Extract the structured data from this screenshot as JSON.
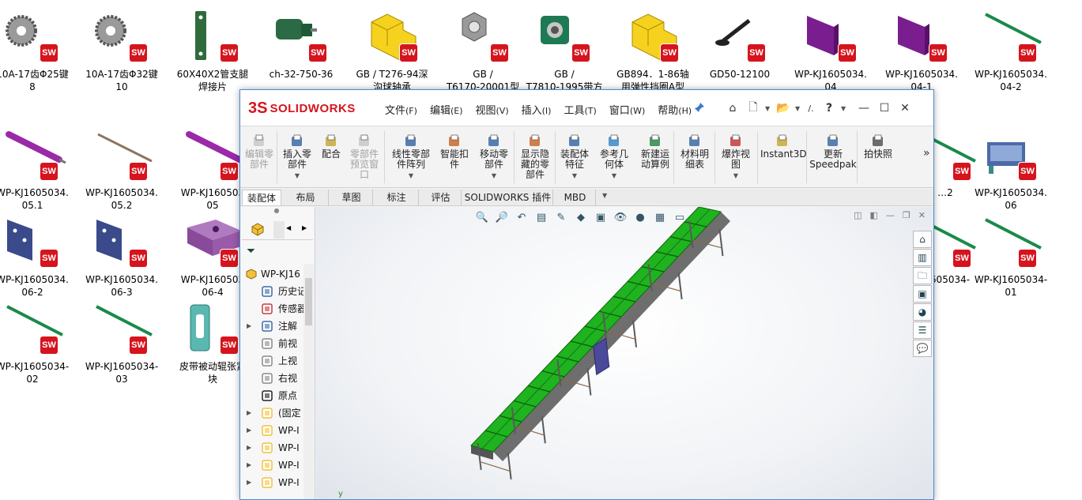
{
  "desktop": {
    "files": [
      {
        "label": "10A-17齿Φ25键\n8",
        "thumb": "sprocket-icon"
      },
      {
        "label": "10A-17齿Φ32键\n10",
        "thumb": "sprocket-icon"
      },
      {
        "label": "60X40X2管支腿\n焊接片",
        "thumb": "plate-icon"
      },
      {
        "label": "ch-32-750-36",
        "thumb": "motor-icon"
      },
      {
        "label": "GB / T276-94深\n沟球轴承",
        "thumb": "block-icon"
      },
      {
        "label": "GB /\nT6170-20001型",
        "thumb": "nut-icon"
      },
      {
        "label": "GB /\nT7810-1995带方",
        "thumb": "bearing-icon"
      },
      {
        "label": "GB894．1-86轴\n用弹性挡圈A型",
        "thumb": "block-icon"
      },
      {
        "label": "GD50-12100",
        "thumb": "foot-icon"
      },
      {
        "label": "WP-KJ1605034.\n04",
        "thumb": "panel-icon"
      },
      {
        "label": "WP-KJ1605034.\n04-1",
        "thumb": "panel-icon"
      },
      {
        "label": "WP-KJ1605034.\n04-2",
        "thumb": "rod-icon"
      },
      {
        "label": "WP-KJ1605034.\n05.1",
        "thumb": "roller-icon"
      },
      {
        "label": "WP-KJ1605034.\n05.2",
        "thumb": "shaft-icon"
      },
      {
        "label": "WP-KJ160503\n05",
        "thumb": "roller-icon"
      },
      {
        "label": "WP-KJ1605034.\n06",
        "thumb": "machine-icon"
      },
      {
        "label": "…2",
        "thumb": "rod-icon"
      },
      {
        "label": "WP-KJ1605034.\n06-2",
        "thumb": "bracket-icon"
      },
      {
        "label": "WP-KJ1605034.\n06-3",
        "thumb": "bracket-icon"
      },
      {
        "label": "WP-KJ160503\n06-4",
        "thumb": "block-purple-icon"
      },
      {
        "label": "…605034-",
        "thumb": "rod-icon"
      },
      {
        "label": "WP-KJ1605034-\n01",
        "thumb": "rod-icon"
      },
      {
        "label": "WP-KJ1605034-\n02",
        "thumb": "rod-icon"
      },
      {
        "label": "WP-KJ1605034-\n03",
        "thumb": "rod-icon"
      },
      {
        "label": "皮带被动辊张紧\n块",
        "thumb": "tensioner-icon"
      }
    ],
    "badge": "SW"
  },
  "app": {
    "logo_ds": "3S",
    "logo_name": "SOLIDWORKS",
    "menus": [
      {
        "label": "文件",
        "acc": "(F)"
      },
      {
        "label": "编辑",
        "acc": "(E)"
      },
      {
        "label": "视图",
        "acc": "(V)"
      },
      {
        "label": "插入",
        "acc": "(I)"
      },
      {
        "label": "工具",
        "acc": "(T)"
      },
      {
        "label": "窗口",
        "acc": "(W)"
      },
      {
        "label": "帮助",
        "acc": "(H)"
      }
    ],
    "title_tools": {
      "home": "⌂",
      "new": "🗋",
      "open": "📂",
      "search_text": "/.",
      "help": "?"
    },
    "window_controls": {
      "minimize": "—",
      "maximize": "☐",
      "close": "✕"
    }
  },
  "commands": [
    {
      "label": "编辑零\n部件",
      "disabled": true
    },
    {
      "label": "插入零\n部件",
      "disabled": false,
      "dropdown": true
    },
    {
      "label": "配合",
      "disabled": false
    },
    {
      "label": "零部件\n预览窗\n口",
      "disabled": true
    },
    {
      "label": "线性零部\n件阵列",
      "disabled": false,
      "dropdown": true
    },
    {
      "label": "智能扣\n件",
      "disabled": false
    },
    {
      "label": "移动零\n部件",
      "disabled": false,
      "dropdown": true
    },
    {
      "label": "显示隐\n藏的零\n部件",
      "disabled": false
    },
    {
      "label": "装配体\n特征",
      "disabled": false,
      "dropdown": true
    },
    {
      "label": "参考几\n何体",
      "disabled": false,
      "dropdown": true
    },
    {
      "label": "新建运\n动算例",
      "disabled": false
    },
    {
      "label": "材料明\n细表",
      "disabled": false
    },
    {
      "label": "爆炸视\n图",
      "disabled": false,
      "dropdown": true
    },
    {
      "label": "Instant3D",
      "disabled": false
    },
    {
      "label": "更新\nSpeedpak",
      "disabled": false
    },
    {
      "label": "拍快照",
      "disabled": false
    }
  ],
  "more_glyph": "»",
  "tabs": [
    "装配体",
    "布局",
    "草图",
    "标注",
    "评估",
    "SOLIDWORKS 插件",
    "MBD"
  ],
  "tree": {
    "root": "WP-KJ16",
    "items": [
      {
        "label": "历史记",
        "icon": "history-icon",
        "arrow": ""
      },
      {
        "label": "传感器",
        "icon": "sensor-icon",
        "arrow": ""
      },
      {
        "label": "注解",
        "icon": "annotation-icon",
        "arrow": "▶"
      },
      {
        "label": "前视",
        "icon": "plane-icon",
        "arrow": ""
      },
      {
        "label": "上视",
        "icon": "plane-icon",
        "arrow": ""
      },
      {
        "label": "右视",
        "icon": "plane-icon",
        "arrow": ""
      },
      {
        "label": "原点",
        "icon": "origin-icon",
        "arrow": ""
      },
      {
        "label": "(固定",
        "icon": "part-icon",
        "arrow": "▶"
      },
      {
        "label": "WP-I",
        "icon": "part-icon",
        "arrow": "▶"
      },
      {
        "label": "WP-I",
        "icon": "part-icon",
        "arrow": "▶"
      },
      {
        "label": "WP-I",
        "icon": "part-icon",
        "arrow": "▶"
      },
      {
        "label": "WP-I",
        "icon": "part-icon",
        "arrow": "▶"
      }
    ]
  },
  "viewport": {
    "model": "belt-conveyor-assembly",
    "belt_color": "#1fb31f",
    "frame_color": "#5a5a5a"
  },
  "colors": {
    "sw_red": "#d6141d",
    "window_border": "#4a8bd6"
  }
}
